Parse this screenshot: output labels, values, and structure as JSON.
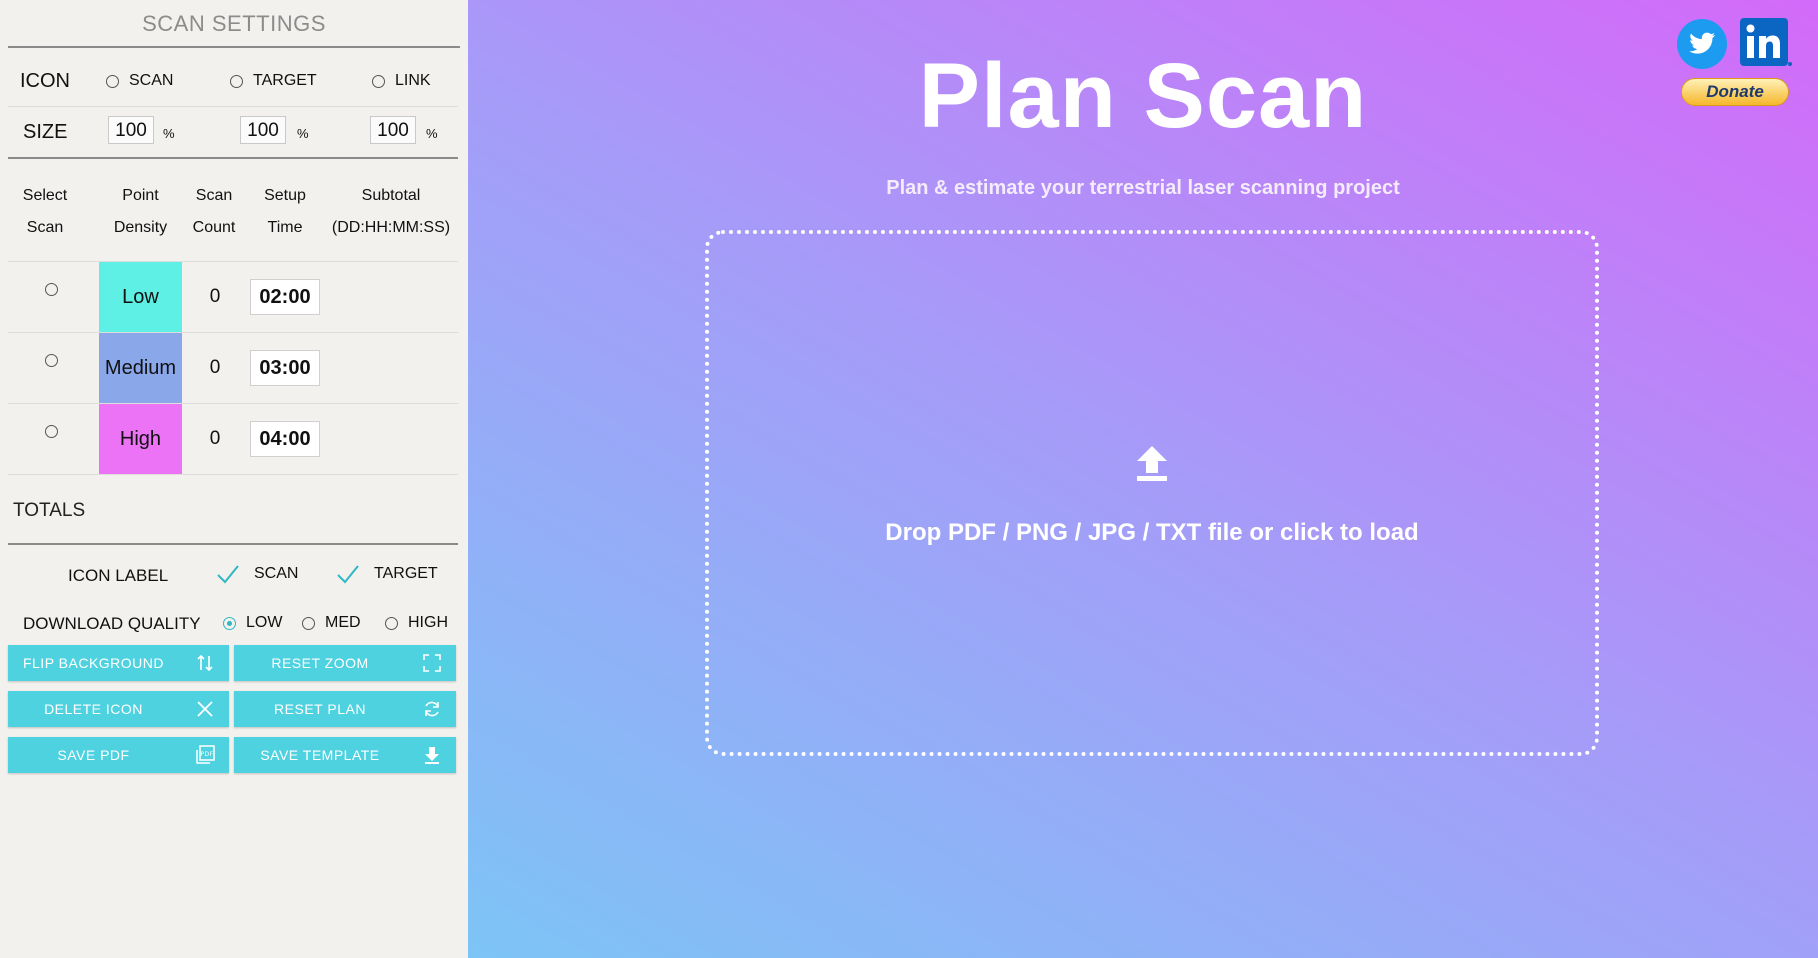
{
  "sidebar": {
    "title": "SCAN SETTINGS",
    "icon_row": {
      "label": "ICON",
      "options": [
        "SCAN",
        "TARGET",
        "LINK"
      ]
    },
    "size_row": {
      "label": "SIZE",
      "values": [
        "100",
        "100",
        "100"
      ],
      "unit": "%"
    },
    "table": {
      "headers": [
        {
          "line1": "Select",
          "line2": "Scan"
        },
        {
          "line1": "Point",
          "line2": "Density"
        },
        {
          "line1": "Scan",
          "line2": "Count"
        },
        {
          "line1": "Setup",
          "line2": "Time"
        },
        {
          "line1": "Subtotal",
          "line2": "(DD:HH:MM:SS)"
        }
      ],
      "rows": [
        {
          "density": "Low",
          "color": "#5ef0e4",
          "count": "0",
          "time": "02:00"
        },
        {
          "density": "Medium",
          "color": "#8aa7ea",
          "count": "0",
          "time": "03:00"
        },
        {
          "density": "High",
          "color": "#ec73f5",
          "count": "0",
          "time": "04:00"
        }
      ],
      "totals_label": "TOTALS"
    },
    "icon_label": {
      "label": "ICON LABEL",
      "options": [
        "SCAN",
        "TARGET"
      ]
    },
    "download_quality": {
      "label": "DOWNLOAD QUALITY",
      "options": [
        "LOW",
        "MED",
        "HIGH"
      ],
      "selected": "LOW"
    },
    "buttons": {
      "flip_background": "FLIP BACKGROUND",
      "reset_zoom": "RESET ZOOM",
      "delete_icon": "DELETE ICON",
      "reset_plan": "RESET PLAN",
      "save_pdf": "SAVE PDF",
      "save_template": "SAVE TEMPLATE"
    }
  },
  "main": {
    "title": "Plan Scan",
    "subtitle": "Plan & estimate your terrestrial laser scanning project",
    "dropzone_text": "Drop PDF / PNG / JPG / TXT file or click to load",
    "donate_label": "Donate"
  },
  "colors": {
    "button": "#4fd2e0",
    "accent": "#2eb8c4"
  },
  "icons": [
    "twitter-icon",
    "linkedin-icon",
    "upload-icon",
    "flip-icon",
    "fullscreen-icon",
    "close-icon",
    "refresh-icon",
    "pdf-icon",
    "download-icon",
    "check-icon"
  ]
}
